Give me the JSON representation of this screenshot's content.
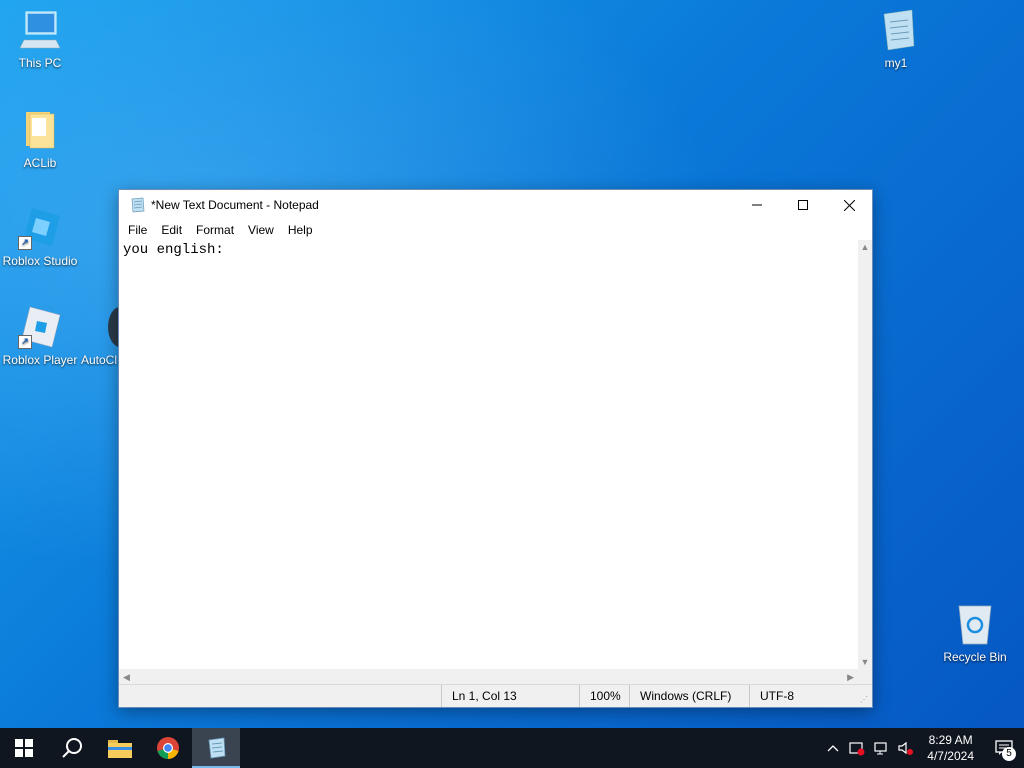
{
  "desktop": {
    "icons": [
      {
        "label": "This PC"
      },
      {
        "label": "ACLib"
      },
      {
        "label": "Roblox Studio"
      },
      {
        "label": "Roblox Player"
      },
      {
        "label": "AutoCl"
      },
      {
        "label": "my1"
      },
      {
        "label": "Recycle Bin"
      }
    ]
  },
  "notepad": {
    "title": "*New Text Document - Notepad",
    "menu": [
      "File",
      "Edit",
      "Format",
      "View",
      "Help"
    ],
    "content": "you english:",
    "status": {
      "position": "Ln 1, Col 13",
      "zoom": "100%",
      "line_ending": "Windows (CRLF)",
      "encoding": "UTF-8"
    }
  },
  "taskbar": {
    "time": "8:29 AM",
    "date": "4/7/2024",
    "notification_count": "5"
  }
}
